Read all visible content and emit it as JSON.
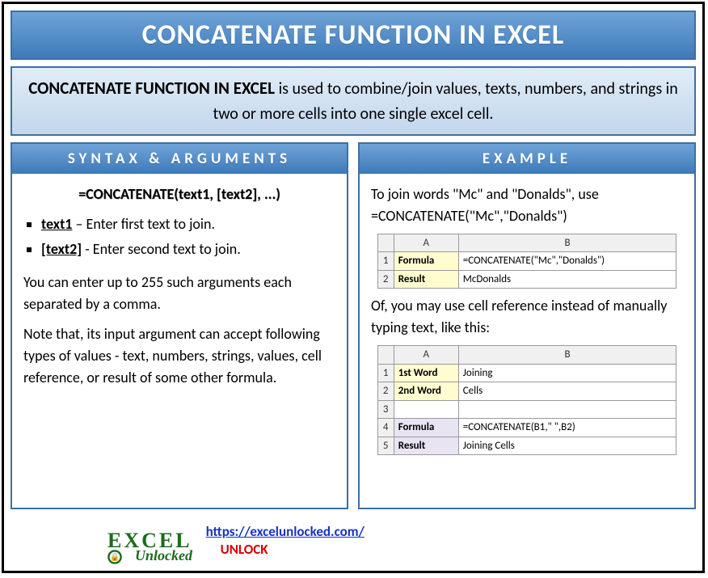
{
  "title": "CONCATENATE FUNCTION IN EXCEL",
  "description": {
    "bold": "CONCATENATE FUNCTION IN EXCEL",
    "rest": " is used to combine/join values, texts, numbers, and strings in two or more cells into one single excel cell."
  },
  "syntax": {
    "header": "SYNTAX & ARGUMENTS",
    "formula": "=CONCATENATE(text1, [text2], ...)",
    "args": [
      {
        "name": "text1",
        "desc": " – Enter first text to join."
      },
      {
        "name": "[text2]",
        "desc": " - Enter second text to join."
      }
    ],
    "para1": "You can enter up to 255 such arguments each separated by a comma.",
    "para2": "Note that, its input argument can accept following types of values - text, numbers, strings, values, cell reference, or result of some other formula."
  },
  "example": {
    "header": "EXAMPLE",
    "intro1": "To join words \"Mc\" and \"Donalds\", use =CONCATENATE(\"Mc\",\"Donalds\")",
    "table1": {
      "colA": "A",
      "colB": "B",
      "rows": [
        {
          "n": "1",
          "a": "Formula",
          "b": "=CONCATENATE(\"Mc\",\"Donalds\")"
        },
        {
          "n": "2",
          "a": "Result",
          "b": "McDonalds"
        }
      ]
    },
    "intro2": "Of, you may use cell reference instead of manually typing text, like this:",
    "table2": {
      "colA": "A",
      "colB": "B",
      "rows": [
        {
          "n": "1",
          "a": "1st Word",
          "b": "Joining",
          "cls": "ylw"
        },
        {
          "n": "2",
          "a": "2nd Word",
          "b": "Cells",
          "cls": "ylw"
        },
        {
          "n": "3",
          "a": "",
          "b": "",
          "cls": ""
        },
        {
          "n": "4",
          "a": "Formula",
          "b": "=CONCATENATE(B1,\" \",B2)",
          "cls": "lbl"
        },
        {
          "n": "5",
          "a": "Result",
          "b": "Joining Cells",
          "cls": "lbl"
        }
      ]
    }
  },
  "footer": {
    "logo_top": "EXCEL",
    "logo_bottom": "Unlocked",
    "url": "https://excelunlocked.com/",
    "unlock": "UNLOCK"
  }
}
